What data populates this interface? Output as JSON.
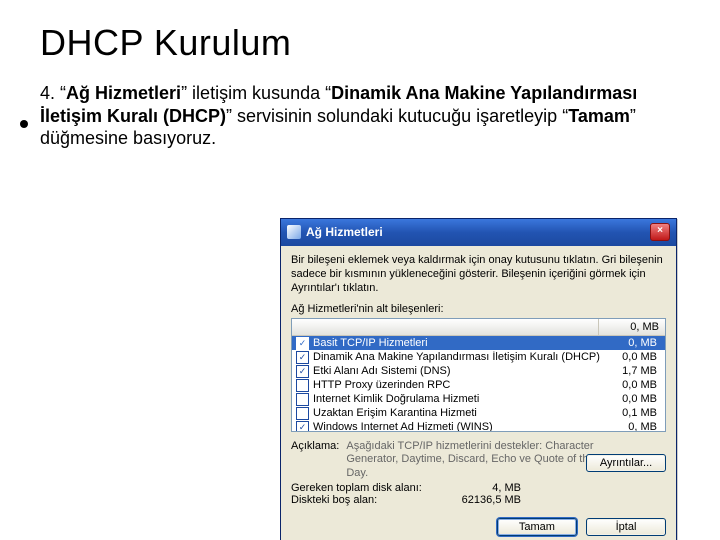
{
  "slide": {
    "title": "DHCP Kurulum",
    "step_number": "4.",
    "text_plain": "“Ağ Hizmetleri” iletişim kusunda “Dinamik Ana Makine Yapılandırması İletişim Kuralı (DHCP)” servisinin solundaki kutucuğu işaretleyip “Tamam” düğmesine basıyoruz."
  },
  "dialog": {
    "title": "Ağ Hizmetleri",
    "close_glyph": "×",
    "intro": "Bir bileşeni eklemek veya kaldırmak için onay kutusunu tıklatın. Gri bileşenin sadece bir kısmının yükleneceğini gösterir. Bileşenin içeriğini görmek için Ayrıntılar'ı tıklatın.",
    "sub_label": "Ağ Hizmetleri'nin alt bileşenleri:",
    "columns": {
      "name_blank": "",
      "size": "0,  MB"
    },
    "items": [
      {
        "checked": true,
        "selected": true,
        "label": "Basit TCP/IP Hizmetleri",
        "size": "0,  MB"
      },
      {
        "checked": true,
        "selected": false,
        "label": "Dinamik Ana Makine Yapılandırması İletişim Kuralı (DHCP)",
        "size": "0,0 MB"
      },
      {
        "checked": true,
        "selected": false,
        "label": "Etki Alanı Adı Sistemi (DNS)",
        "size": "1,7 MB"
      },
      {
        "checked": false,
        "selected": false,
        "label": "HTTP Proxy üzerinden RPC",
        "size": "0,0 MB"
      },
      {
        "checked": false,
        "selected": false,
        "label": "Internet Kimlik Doğrulama Hizmeti",
        "size": "0,0 MB"
      },
      {
        "checked": false,
        "selected": false,
        "label": "Uzaktan Erişim Karantina Hizmeti",
        "size": "0,1 MB"
      },
      {
        "checked": true,
        "selected": false,
        "label": "Windows Internet Ad Hizmeti (WINS)",
        "size": "0,  MB"
      }
    ],
    "desc_label": "Açıklama:",
    "desc_text": "Aşağıdaki TCP/IP hizmetlerini destekler: Character Generator, Daytime, Discard, Echo ve Quote of the Day.",
    "req_label": "Gereken toplam disk alanı:",
    "req_value": "4,  MB",
    "free_label": "Diskteki boş alan:",
    "free_value": "62136,5 MB",
    "details_btn": "Ayrıntılar...",
    "ok_btn": "Tamam",
    "cancel_btn": "İptal"
  }
}
